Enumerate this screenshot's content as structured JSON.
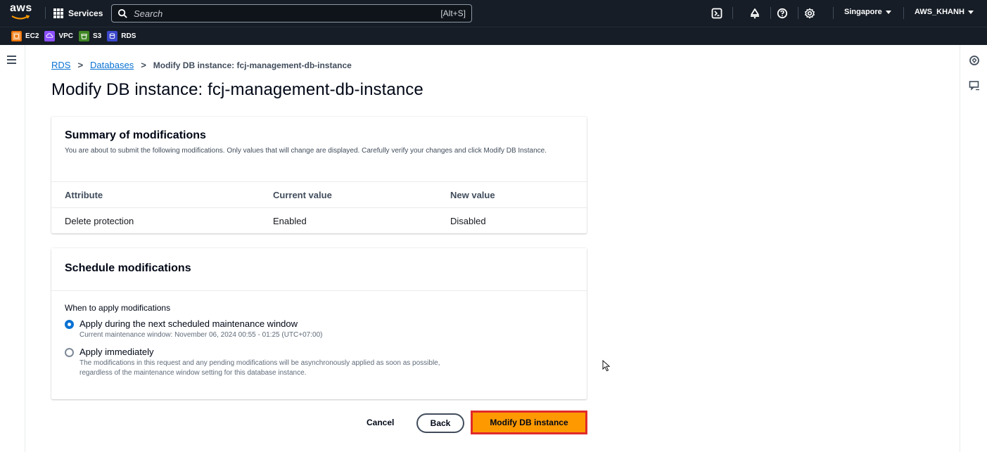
{
  "topnav": {
    "logo_text": "aws",
    "services_label": "Services",
    "search_placeholder": "Search",
    "search_shortcut": "[Alt+S]",
    "icons": [
      "cloudshell-icon",
      "bell-icon",
      "help-icon",
      "settings-icon"
    ],
    "region": "Singapore",
    "account": "AWS_KHANH"
  },
  "favorites": [
    {
      "label": "EC2",
      "color": "#ed7100",
      "icon": "ec2-icon"
    },
    {
      "label": "VPC",
      "color": "#8c4fff",
      "icon": "vpc-icon"
    },
    {
      "label": "S3",
      "color": "#3f8624",
      "icon": "s3-icon"
    },
    {
      "label": "RDS",
      "color": "#3b48cc",
      "icon": "rds-icon"
    }
  ],
  "breadcrumb": {
    "item1": "RDS",
    "item2": "Databases",
    "current": "Modify DB instance: fcj-management-db-instance"
  },
  "page_title": "Modify DB instance: fcj-management-db-instance",
  "summary": {
    "title": "Summary of modifications",
    "description": "You are about to submit the following modifications. Only values that will change are displayed. Carefully verify your changes and click Modify DB Instance.",
    "columns": [
      "Attribute",
      "Current value",
      "New value"
    ],
    "rows": [
      [
        "Delete protection",
        "Enabled",
        "Disabled"
      ]
    ]
  },
  "schedule": {
    "title": "Schedule modifications",
    "field_label": "When to apply modifications",
    "options": [
      {
        "label": "Apply during the next scheduled maintenance window",
        "description": "Current maintenance window: November 06, 2024 00:55 - 01:25 (UTC+07:00)",
        "selected": true
      },
      {
        "label": "Apply immediately",
        "description": "The modifications in this request and any pending modifications will be asynchronously applied as soon as possible, regardless of the maintenance window setting for this database instance.",
        "selected": false
      }
    ]
  },
  "actions": {
    "cancel": "Cancel",
    "back": "Back",
    "submit": "Modify DB instance"
  },
  "colors": {
    "nav_bg": "#161d26",
    "link": "#0972d3",
    "primary": "#ff9900",
    "highlight_border": "#e12a2a"
  }
}
